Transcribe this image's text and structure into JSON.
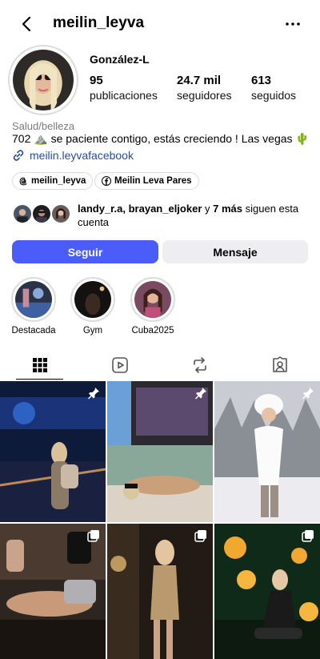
{
  "header": {
    "username": "meilin_leyva",
    "back_icon": "chevron-left-icon",
    "more_icon": "more-horizontal-icon"
  },
  "profile": {
    "display_name": "González-L",
    "stats": [
      {
        "value": "95",
        "label": "publicaciones"
      },
      {
        "value": "24.7 mil",
        "label": "seguidores"
      },
      {
        "value": "613",
        "label": "seguidos"
      }
    ],
    "category": "Salud/belleza",
    "bio": "702 ⛰️ se paciente contigo, estás creciendo ! Las vegas 🌵",
    "link": "meilin.leyvafacebook",
    "chips": [
      {
        "icon": "threads-icon",
        "label": "meilin_leyva"
      },
      {
        "icon": "facebook-icon",
        "label": "Meilin Leva Pares"
      }
    ],
    "followed_by": {
      "user1": "landy_r.a",
      "sep": ", ",
      "user2": "brayan_eljoker",
      "mid": " y ",
      "more": "7 más",
      "tail": " siguen esta cuenta"
    }
  },
  "actions": {
    "follow": "Seguir",
    "message": "Mensaje"
  },
  "highlights": [
    {
      "label": "Destacada"
    },
    {
      "label": "Gym"
    },
    {
      "label": "Cuba2025"
    }
  ],
  "tabs": [
    {
      "icon": "grid-icon",
      "active": true
    },
    {
      "icon": "reels-icon",
      "active": false
    },
    {
      "icon": "reposts-icon",
      "active": false
    },
    {
      "icon": "tagged-icon",
      "active": false
    }
  ],
  "colors": {
    "accent": "#4a5df9",
    "link": "#2a4f8f"
  },
  "posts": [
    {
      "badge": "pin-icon"
    },
    {
      "badge": "pin-icon"
    },
    {
      "badge": "pin-icon"
    },
    {
      "badge": "multiple-icon"
    },
    {
      "badge": "multiple-icon"
    },
    {
      "badge": "multiple-icon"
    }
  ]
}
